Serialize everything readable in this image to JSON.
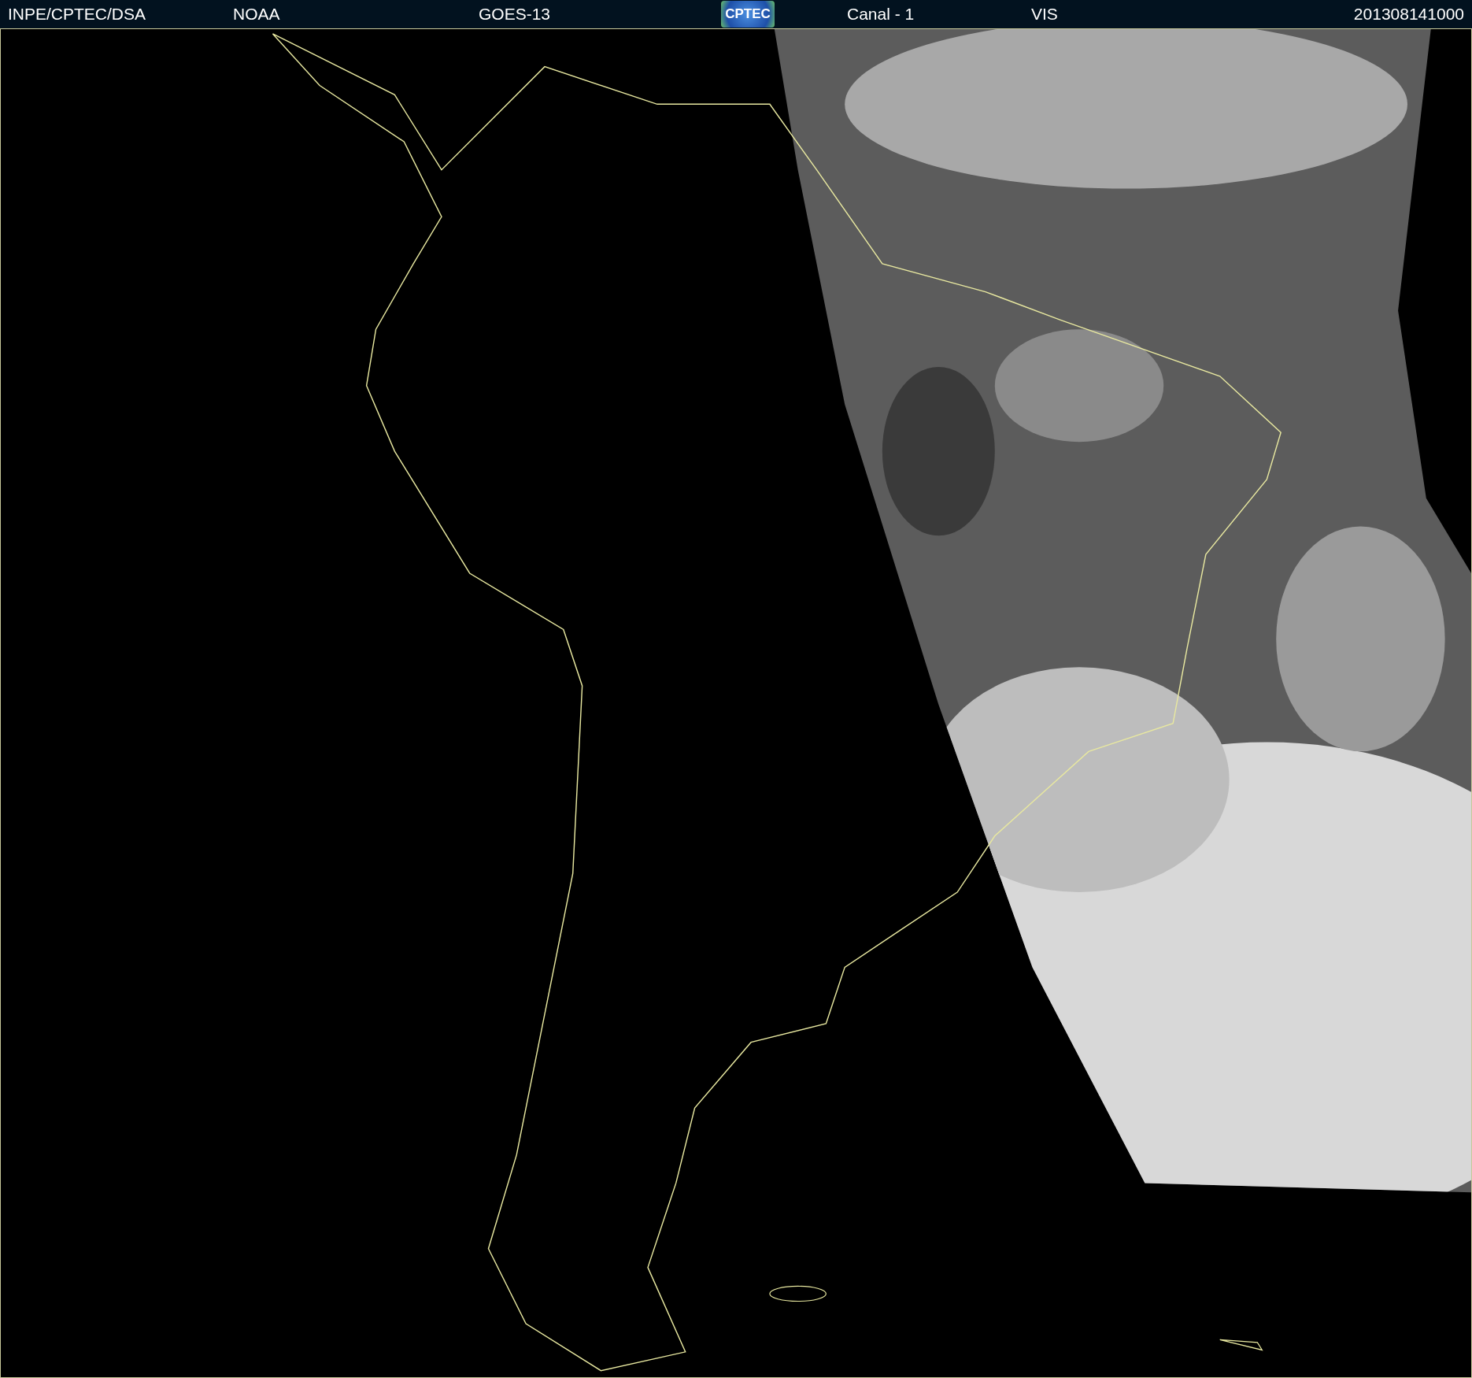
{
  "header": {
    "source": "INPE/CPTEC/DSA",
    "agency": "NOAA",
    "satellite": "GOES-13",
    "logo_text": "CPTEC",
    "channel": "Canal - 1",
    "band": "VIS",
    "timestamp": "201308141000"
  }
}
